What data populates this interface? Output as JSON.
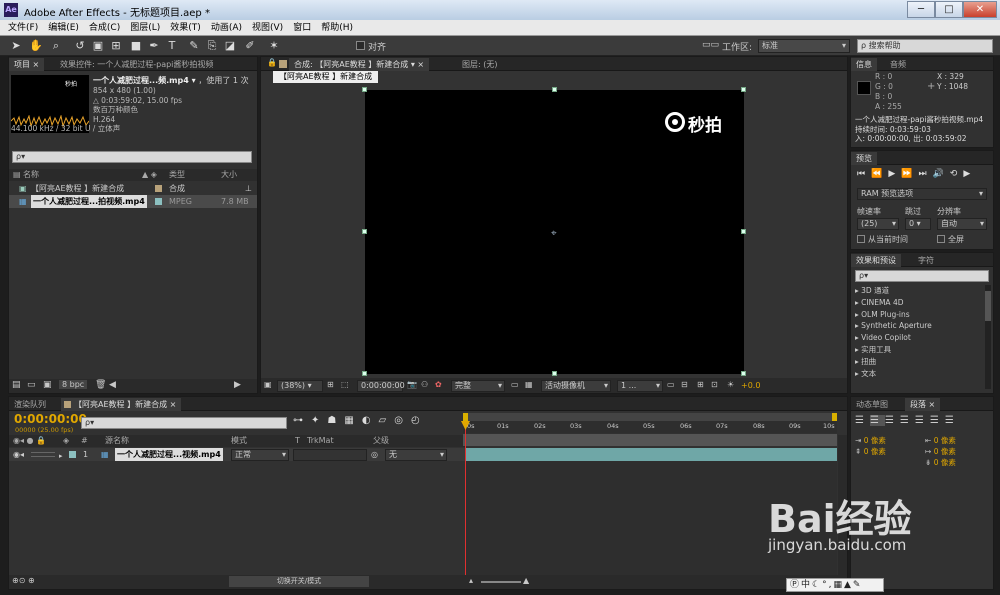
{
  "window": {
    "title": "Adobe After Effects - 无标题项目.aep *",
    "icon": "Ae"
  },
  "menu": [
    "文件(F)",
    "编辑(E)",
    "合成(C)",
    "图层(L)",
    "效果(T)",
    "动画(A)",
    "视图(V)",
    "窗口",
    "帮助(H)"
  ],
  "toolbar": {
    "align_label": "对齐",
    "workspace_label": "工作区:",
    "workspace_value": "标准",
    "search_placeholder": "搜索帮助"
  },
  "project": {
    "tab_project": "项目",
    "tab_effects": "效果控件: 一个人减肥过程-papi酱秒拍视频",
    "item_name": "一个人减肥过程...频.mp4",
    "item_used": "，使用了 1 次",
    "info": [
      "854 x 480 (1.00)",
      "△ 0:03:59:02, 15.00 fps",
      "数百万种颜色",
      "H.264",
      "44.100 kHz / 32 bit U / 立体声"
    ],
    "thumb_logo": "秒拍",
    "search_placeholder": "ρ▾",
    "columns": {
      "name": "名称",
      "type": "类型",
      "size": "大小"
    },
    "rows": [
      {
        "name": "【阿亮AE教程 】新建合成",
        "type": "合成",
        "size": "",
        "color": "#b8a27a"
      },
      {
        "name": "一个人减肥过程...拍视频.mp4",
        "type": "MPEG",
        "size": "7.8 MB",
        "color": "#8cc0c0"
      }
    ],
    "bpc": "8 bpc"
  },
  "comp": {
    "tab_comp": "合成: 【阿亮AE教程 】新建合成",
    "tab_layer": "图层: (无)",
    "breadcrumb": "【阿亮AE教程 】新建合成",
    "logo_text": "秒拍",
    "zoom": "(38%)",
    "timecode": "0:00:00:00",
    "resolution": "完整",
    "camera": "活动摄像机",
    "views": "1 ...",
    "exposure": "+0.0"
  },
  "info_panel": {
    "tab_info": "信息",
    "tab_audio": "音频",
    "rgba": [
      "R : 0",
      "G : 0",
      "B : 0",
      "A : 255"
    ],
    "xy": [
      "X : 329",
      "Y : 1048"
    ],
    "details": [
      "一个人减肥过程-papi酱秒拍视频.mp4",
      "持续时间: 0:03:59:03",
      "入: 0:00:00:00, 出: 0:03:59:02"
    ]
  },
  "preview": {
    "tab": "预览",
    "ram_options": "RAM 预览选项",
    "labels": {
      "frame_rate": "帧速率",
      "skip": "跳过",
      "resolution": "分辨率"
    },
    "values": {
      "frame_rate": "(25)",
      "skip": "0",
      "resolution": "自动"
    },
    "from_current": "从当前时间",
    "fullscreen": "全屏"
  },
  "effects": {
    "tab_effects": "效果和预设",
    "tab_char": "字符",
    "search_placeholder": "ρ▾",
    "items": [
      "3D 通道",
      "CINEMA 4D",
      "OLM Plug-ins",
      "Synthetic Aperture",
      "Video Copilot",
      "实用工具",
      "扭曲",
      "文本"
    ]
  },
  "timeline": {
    "tab_render": "渲染队列",
    "tab_comp": "【阿亮AE教程 】新建合成",
    "timecode": "0:00:00:00",
    "fps": "00000 (25.00 fps)",
    "search_placeholder": "ρ▾",
    "columns": {
      "name": "源名称",
      "mode": "模式",
      "t": "T",
      "trkmat": "TrkMat",
      "parent": "父级"
    },
    "layer": {
      "index": "1",
      "name": "一个人减肥过程...视频.mp4",
      "mode": "正常",
      "parent": "无"
    },
    "ruler": [
      "0s",
      "01s",
      "02s",
      "03s",
      "04s",
      "05s",
      "06s",
      "07s",
      "08s",
      "09s",
      "10s"
    ],
    "toggle_label": "切换开关/模式"
  },
  "paragraph": {
    "tab_motion": "动态草图",
    "tab_para": "段落",
    "px_values": [
      "0 像素",
      "0 像素",
      "0 像素",
      "0 像素",
      "0 像素"
    ]
  },
  "watermark": {
    "brand": "Bai经验",
    "url": "jingyan.baidu.com"
  },
  "colors": {
    "accent": "#e0a700",
    "timecode": "#e0a700"
  }
}
